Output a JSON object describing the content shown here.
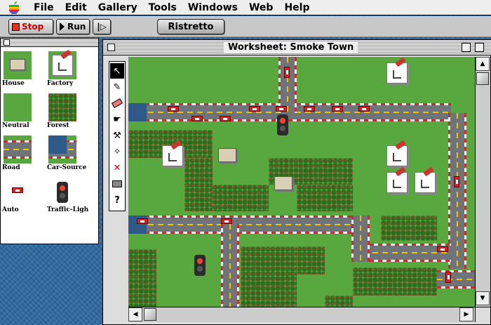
{
  "menubar": {
    "apple_icon": "apple-logo",
    "items": [
      "File",
      "Edit",
      "Gallery",
      "Tools",
      "Windows",
      "Web",
      "Help"
    ]
  },
  "toolbar": {
    "stop_label": "Stop",
    "run_label": "Run",
    "step_label": "|▷",
    "ristretto_label": "Ristretto"
  },
  "palette": {
    "items": [
      {
        "label": "House",
        "icon": "house-icon"
      },
      {
        "label": "Factory",
        "icon": "factory-icon"
      },
      {
        "label": "Neutral",
        "icon": "neutral-icon"
      },
      {
        "label": "Forest",
        "icon": "forest-icon"
      },
      {
        "label": "Road",
        "icon": "road-icon"
      },
      {
        "label": "Car-Source",
        "icon": "car-source-icon"
      },
      {
        "label": "Auto",
        "icon": "auto-icon"
      },
      {
        "label": "Traffic-Ligh",
        "icon": "traffic-light-icon"
      }
    ]
  },
  "worksheet": {
    "title": "Worksheet: Smoke Town",
    "tools": [
      "arrow-tool-icon",
      "pencil-tool-icon",
      "eraser-tool-icon",
      "hand-tool-icon",
      "hammer-tool-icon",
      "wand-tool-icon",
      "disconnect-tool-icon",
      "grid-tool-icon",
      "help-tool-icon"
    ],
    "help_tool_label": "?"
  },
  "colors": {
    "grass": "#59a83f",
    "road": "#6f7478",
    "lane_marking": "#f2c400",
    "car": "#d42222",
    "desktop": "#2f6aa0"
  }
}
